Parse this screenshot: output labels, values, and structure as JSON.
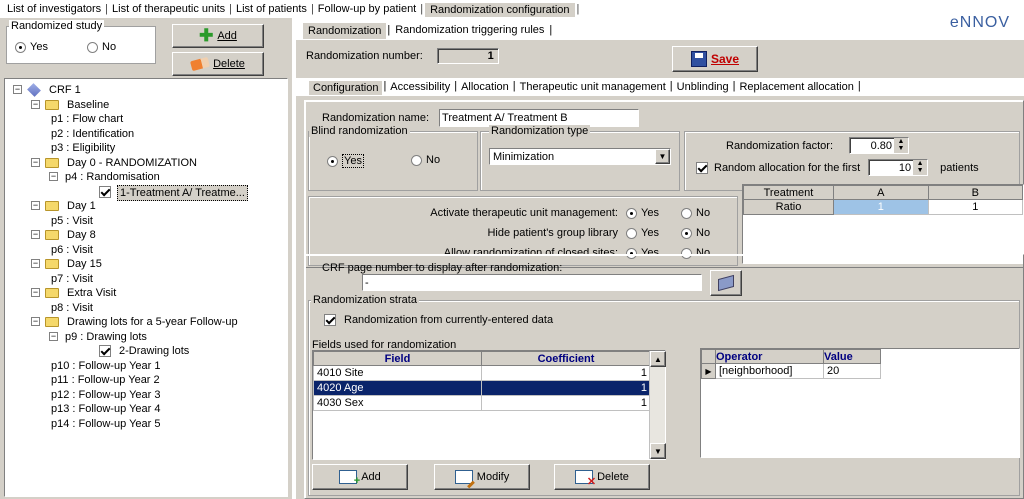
{
  "topmenu": {
    "items": [
      "List of investigators",
      "List of therapeutic units",
      "List of patients",
      "Follow-up by patient",
      "Randomization configuration"
    ]
  },
  "left": {
    "study_legend": "Randomized study",
    "yes": "Yes",
    "no": "No",
    "add": "Add",
    "delete": "Delete",
    "tree": [
      {
        "label": "CRF 1",
        "level": 0,
        "type": "crf"
      },
      {
        "label": "Baseline",
        "level": 1,
        "type": "folder"
      },
      {
        "label": "p1 : Flow chart",
        "level": 2,
        "type": "page"
      },
      {
        "label": "p2 : Identification",
        "level": 2,
        "type": "page"
      },
      {
        "label": "p3 : Eligibility",
        "level": 2,
        "type": "page"
      },
      {
        "label": "Day 0 - RANDOMIZATION",
        "level": 1,
        "type": "folder"
      },
      {
        "label": "p4 : Randomisation",
        "level": 2,
        "type": "pagefolder"
      },
      {
        "label": "1-Treatment A/ Treatme...",
        "level": 3,
        "type": "check",
        "selected": true
      },
      {
        "label": "Day 1",
        "level": 1,
        "type": "folder"
      },
      {
        "label": "p5 : Visit",
        "level": 2,
        "type": "page"
      },
      {
        "label": "Day 8",
        "level": 1,
        "type": "folder"
      },
      {
        "label": "p6 : Visit",
        "level": 2,
        "type": "page"
      },
      {
        "label": "Day 15",
        "level": 1,
        "type": "folder"
      },
      {
        "label": "p7 : Visit",
        "level": 2,
        "type": "page"
      },
      {
        "label": "Extra Visit",
        "level": 1,
        "type": "folder"
      },
      {
        "label": "p8 : Visit",
        "level": 2,
        "type": "page"
      },
      {
        "label": "Drawing lots for a 5-year Follow-up",
        "level": 1,
        "type": "folder"
      },
      {
        "label": "p9 : Drawing lots",
        "level": 2,
        "type": "pagefolder"
      },
      {
        "label": "2-Drawing lots",
        "level": 3,
        "type": "check"
      },
      {
        "label": "p10 : Follow-up Year 1",
        "level": 2,
        "type": "page"
      },
      {
        "label": "p11 : Follow-up Year 2",
        "level": 2,
        "type": "page"
      },
      {
        "label": "p12 : Follow-up Year 3",
        "level": 2,
        "type": "page"
      },
      {
        "label": "p13 : Follow-up Year 4",
        "level": 2,
        "type": "page"
      },
      {
        "label": "p14 : Follow-up Year 5",
        "level": 2,
        "type": "page"
      }
    ]
  },
  "right": {
    "tabs": [
      "Randomization",
      "Randomization triggering rules"
    ],
    "brand": "eNNOV",
    "rand_number_label": "Randomization number:",
    "rand_number_value": "1",
    "save": "Save",
    "subtabs": [
      "Configuration",
      "Accessibility",
      "Allocation",
      "Therapeutic unit management",
      "Unblinding",
      "Replacement allocation"
    ],
    "rand_name_label": "Randomization name:",
    "rand_name_value": "Treatment A/ Treatment B",
    "blind_legend": "Blind randomization",
    "yes": "Yes",
    "no": "No",
    "type_legend": "Randomization type",
    "type_value": "Minimization",
    "factor_label": "Randomization factor:",
    "factor_value": "0.80",
    "random_alloc_label": "Random allocation for the first",
    "random_alloc_value": "10",
    "patients": "patients",
    "activate_label": "Activate therapeutic unit management:",
    "hide_label": "Hide patient's group library",
    "allow_label": "Allow randomization of closed sites:",
    "ratio_table": {
      "headers": [
        "Treatment",
        "A",
        "B"
      ],
      "row": [
        "Ratio",
        "1",
        "1"
      ]
    },
    "crf_page_label": "CRF page number to display after randomization:",
    "crf_page_value": "-",
    "strata_legend": "Randomization strata",
    "strata_check": "Randomization from currently-entered data",
    "fields_label": "Fields used for randomization",
    "fields_headers": [
      "Field",
      "Coefficient"
    ],
    "fields": [
      [
        "4010 Site",
        "1"
      ],
      [
        "4020 Age",
        "1"
      ],
      [
        "4030 Sex",
        "1"
      ]
    ],
    "op_headers": [
      "Operator",
      "Value"
    ],
    "ops": [
      [
        "[neighborhood]",
        "20"
      ]
    ],
    "add": "Add",
    "modify": "Modify",
    "delete": "Delete"
  }
}
